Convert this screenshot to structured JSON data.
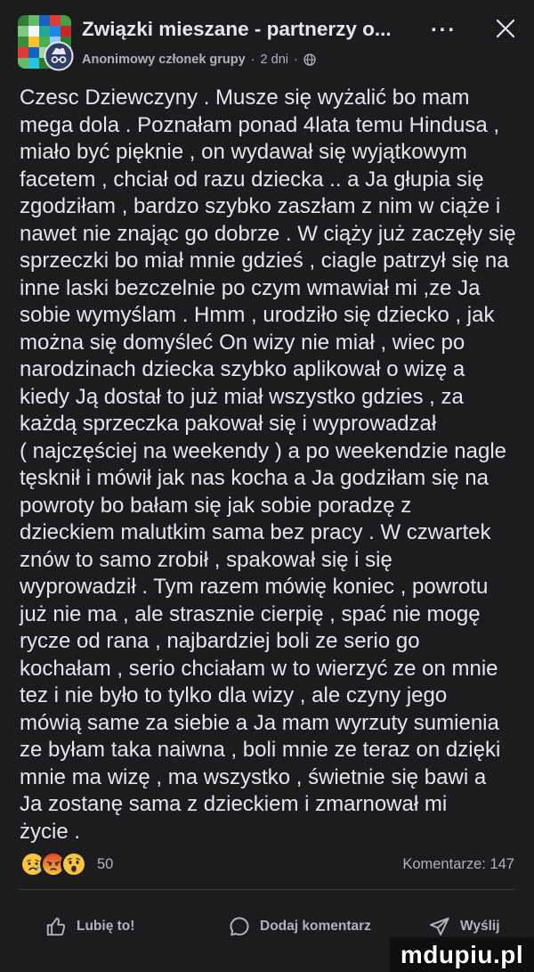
{
  "header": {
    "group_title": "Związki mieszane - partnerzy o...",
    "author": "Anonimowy członek grupy",
    "separator": "·",
    "time": "2 dni",
    "privacy_icon": "globe-icon",
    "avatar_badge_icon": "incognito-icon",
    "more_label": "...",
    "close_icon": "close-icon"
  },
  "post": {
    "lines": [
      "Czesc Dziewczyny . Musze się wyżalić bo mam",
      "mega dola . Poznałam ponad 4lata temu Hindusa ,",
      "miało być pięknie , on wydawał się wyjątkowym",
      "facetem , chciał od razu dziecka .. a Ja głupia się",
      "zgodziłam , bardzo szybko zaszłam z nim w ciąże i",
      "nawet nie znając go dobrze . W ciąży już zaczęły się",
      "sprzeczki bo miał mnie gdzieś , ciagle patrzył się na",
      "inne laski bezczelnie po czym wmawiał mi ,ze Ja",
      "sobie wymyślam . Hmm , urodziło się dziecko , jak",
      "można się domyśleć On wizy nie miał , wiec po",
      "narodzinach dziecka szybko aplikował o wizę a",
      "kiedy Ją dostał to już miał wszystko gdzies , za",
      "każdą sprzeczka pakował się i wyprowadzał",
      "( najczęściej na weekendy ) a po weekendzie nagle",
      "tęsknił i mówił jak nas kocha a Ja godziłam się na",
      "powroty bo bałam się jak sobie poradzę z",
      "dzieckiem malutkim sama bez pracy . W czwartek",
      "znów to samo zrobił , spakował się i się",
      "wyprowadził . Tym razem mówię koniec , powrotu",
      "już nie ma , ale strasznie cierpię , spać nie mogę",
      "rycze od rana , najbardziej boli ze serio go",
      "kochałam , serio chciałam w to wierzyć ze on mnie",
      "tez i nie było to tylko dla wizy , ale czyny jego",
      "mówią same za siebie a Ja mam wyrzuty sumienia",
      "ze byłam taka naiwna , boli mnie ze teraz on dzięki",
      "mnie ma wizę , ma wszystko , świetnie się bawi a",
      "Ja zostanę sama z dzieckiem i zmarnował mi",
      "życie ."
    ]
  },
  "reactions": {
    "icons": [
      "sad-reaction-icon",
      "angry-reaction-icon",
      "wow-reaction-icon"
    ],
    "count": "50"
  },
  "comments": {
    "label": "Komentarze: 147"
  },
  "actions": {
    "like": {
      "label": "Lubię to!",
      "icon": "thumbs-up-icon"
    },
    "comment": {
      "label": "Dodaj komentarz",
      "icon": "comment-icon"
    },
    "share": {
      "label": "Wyślij",
      "icon": "send-icon"
    }
  },
  "watermark": {
    "text": "mdupiu.pl"
  },
  "colors": {
    "background": "#1c1c1e",
    "text_primary": "#e4e6eb",
    "text_secondary": "#b0b3b8",
    "divider": "#3e4042"
  }
}
